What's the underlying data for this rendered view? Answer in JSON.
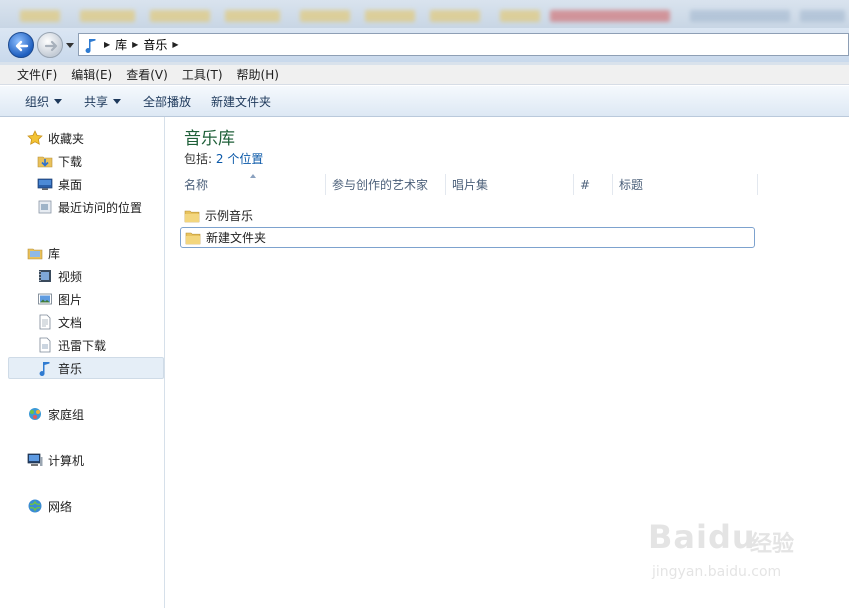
{
  "address": {
    "crumbs": [
      "库",
      "音乐"
    ]
  },
  "menu": {
    "items": [
      "文件(F)",
      "编辑(E)",
      "查看(V)",
      "工具(T)",
      "帮助(H)"
    ]
  },
  "commandbar": {
    "organize": "组织",
    "share": "共享",
    "play_all": "全部播放",
    "new_folder": "新建文件夹"
  },
  "navpane": {
    "favorites": "收藏夹",
    "downloads": "下载",
    "desktop": "桌面",
    "recent": "最近访问的位置",
    "libraries": "库",
    "videos": "视频",
    "pictures": "图片",
    "documents": "文档",
    "xunlei": "迅雷下载",
    "music": "音乐",
    "homegroup": "家庭组",
    "computer": "计算机",
    "network": "网络"
  },
  "content": {
    "title": "音乐库",
    "includes_label": "包括:",
    "includes_link": "2 个位置",
    "columns": [
      "名称",
      "参与创作的艺术家",
      "唱片集",
      "#",
      "标题"
    ],
    "files": [
      {
        "name": "示例音乐"
      },
      {
        "name": "新建文件夹"
      }
    ]
  },
  "watermark": {
    "brand": "Bai",
    "brand2": "du",
    "cn": "经验",
    "url": "jingyan.baidu.com"
  },
  "colors": {
    "title_green": "#1e5f38",
    "link_blue": "#0a58a8",
    "command_text": "#1e395b"
  }
}
